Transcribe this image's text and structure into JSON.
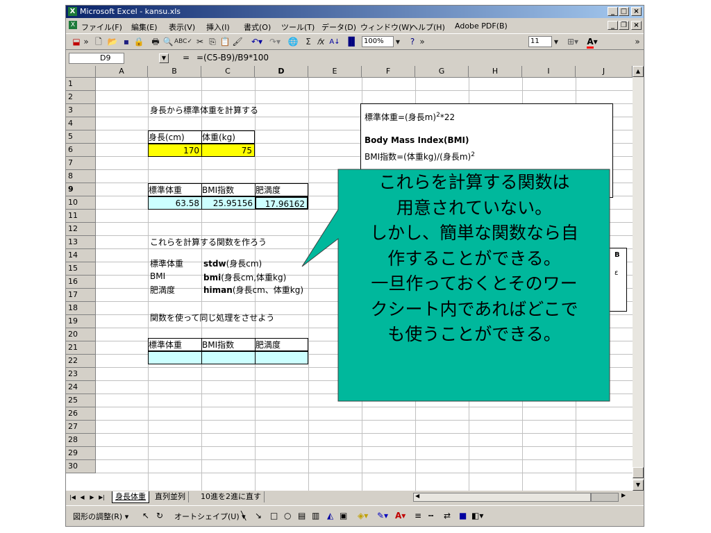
{
  "window": {
    "title": "Microsoft Excel - kansu.xls"
  },
  "menu": [
    "ファイル(F)",
    "編集(E)",
    "表示(V)",
    "挿入(I)",
    "書式(O)",
    "ツール(T)",
    "データ(D)",
    "ウィンドウ(W)",
    "ヘルプ(H)",
    "Adobe PDF(B)"
  ],
  "toolbar": {
    "zoom": "100%",
    "font_size": "11"
  },
  "formula_bar": {
    "name_box": "D9",
    "equals": "=",
    "formula": "=(C5-B9)/B9*100"
  },
  "columns": [
    "A",
    "B",
    "C",
    "D",
    "E",
    "F",
    "G",
    "H",
    "I",
    "J"
  ],
  "rows": [
    "1",
    "2",
    "3",
    "4",
    "5",
    "6",
    "7",
    "8",
    "9",
    "10",
    "11",
    "12",
    "13",
    "14",
    "15",
    "16",
    "17",
    "18",
    "19",
    "20",
    "21",
    "22",
    "23",
    "24",
    "25",
    "26",
    "27",
    "28",
    "29",
    "30"
  ],
  "cells": {
    "B2": "身長から標準体重を計算する",
    "B4": "身長(cm)",
    "C4": "体重(kg)",
    "B5": "170",
    "C5": "75",
    "B8": "標準体重",
    "C8": "BMI指数",
    "D8": "肥満度",
    "B9": "63.58",
    "C9": "25.95156",
    "D9": "17.96162",
    "B12": "これらを計算する関数を作ろう",
    "B13": "標準体重",
    "C13_name": "stdw",
    "C13_args": "(身長cm)",
    "B14": "BMI",
    "C14_name": "bmi",
    "C14_args": "(身長cm,体重kg)",
    "B15": "肥満度",
    "C15_name": "himan",
    "C15_args": "(身長cm、体重kg)",
    "B17": "関数を使って同じ処理をさせよう",
    "B19": "標準体重",
    "C19": "BMI指数",
    "D19": "肥満度"
  },
  "textbox": {
    "line1_pre": "標準体重=(身長m)",
    "line1_sup": "2",
    "line1_post": "*22",
    "line2": "Body Mass Index(BMI)",
    "line3_pre": "BMI指数=(体重kg)/(身長m)",
    "line3_sup": "2"
  },
  "hidden_box_fragments": {
    "a": "B",
    "b": "ε"
  },
  "callout": {
    "lines": [
      "これらを計算する関数は",
      "用意されていない。",
      "しかし、簡単な関数なら自",
      "作することができる。",
      "一旦作っておくとそのワー",
      "クシート内であればどこで",
      "も使うことができる。"
    ],
    "fill": "#00b89c"
  },
  "sheet_tabs": [
    "身長体重",
    "直列並列",
    "10進を2進に直す"
  ],
  "drawing_toolbar": {
    "draw_menu": "図形の調整(R) ▾",
    "autoshape_menu": "オートシェイプ(U) ▾"
  },
  "colors": {
    "input_fill": "#ffff00",
    "output_fill": "#ccffff",
    "titlebar": "#0a246a"
  }
}
